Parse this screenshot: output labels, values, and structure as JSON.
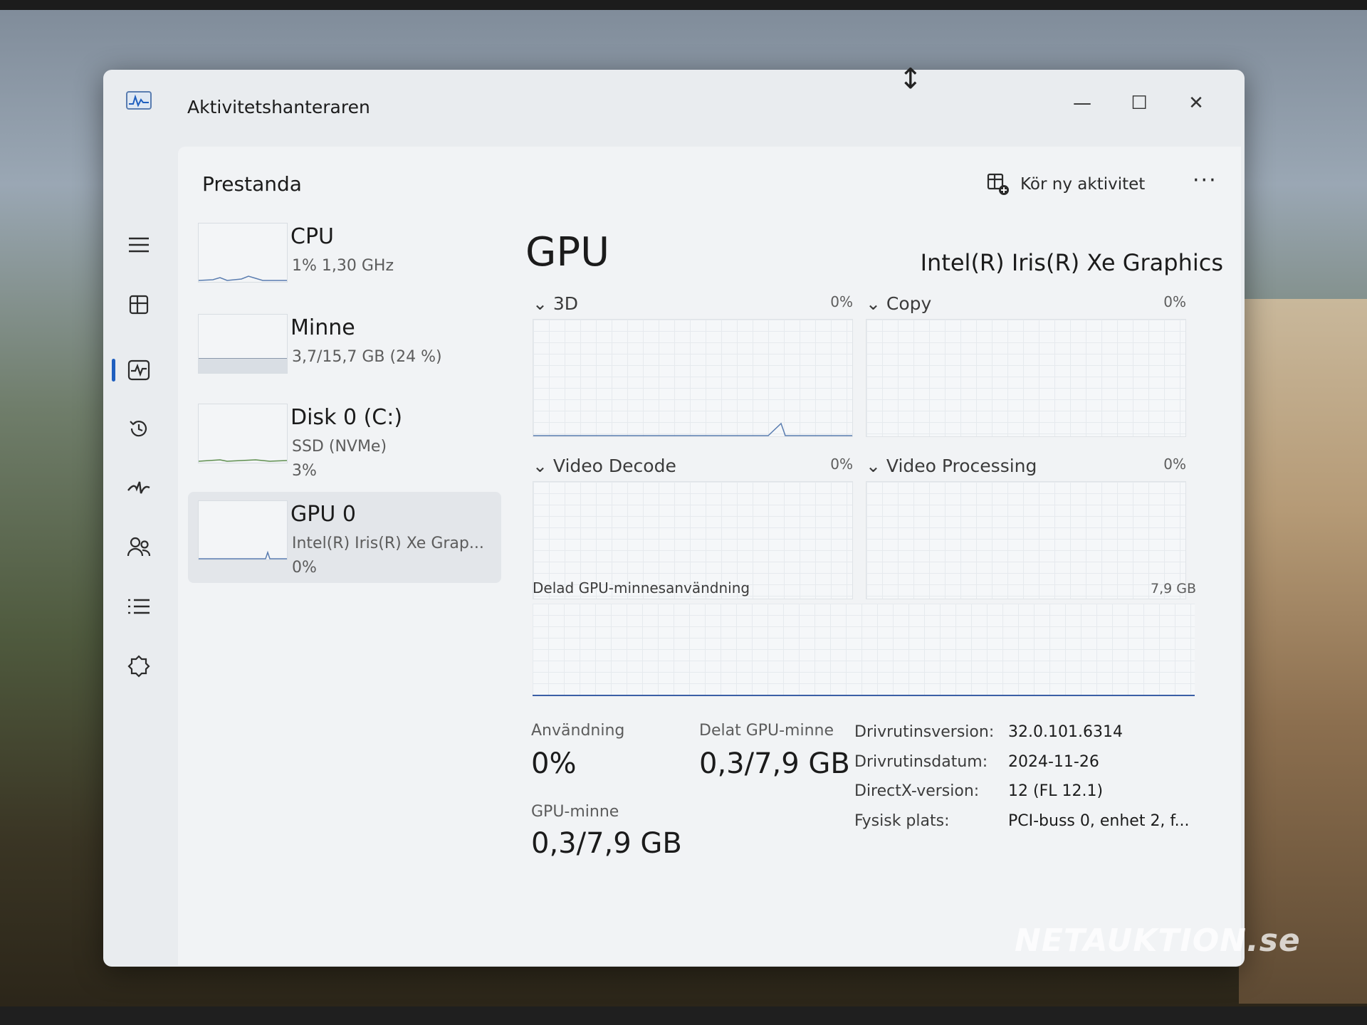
{
  "window": {
    "title": "Aktivitetshanteraren",
    "controls": {
      "minimize": "—",
      "maximize": "☐",
      "close": "✕"
    }
  },
  "header": {
    "page_title": "Prestanda",
    "run_task_label": "Kör ny aktivitet",
    "more_label": "···"
  },
  "nav": {
    "items": [
      "menu-icon",
      "processes-icon",
      "performance-icon",
      "app-history-icon",
      "startup-apps-icon",
      "users-icon",
      "details-icon",
      "services-icon",
      "settings-icon"
    ],
    "active": "performance-icon",
    "accent": "#1f5fbf"
  },
  "perf_list": [
    {
      "name": "CPU",
      "line1": "1%  1,30 GHz",
      "line2": ""
    },
    {
      "name": "Minne",
      "line1": "3,7/15,7 GB (24 %)",
      "line2": ""
    },
    {
      "name": "Disk 0 (C:)",
      "line1": "SSD (NVMe)",
      "line2": "3%"
    },
    {
      "name": "GPU 0",
      "line1": "Intel(R) Iris(R) Xe Grap...",
      "line2": "0%"
    }
  ],
  "detail": {
    "title": "GPU",
    "model": "Intel(R) Iris(R) Xe Graphics",
    "engines": [
      {
        "label": "3D",
        "percent": "0%"
      },
      {
        "label": "Copy",
        "percent": "0%"
      },
      {
        "label": "Video Decode",
        "percent": "0%"
      },
      {
        "label": "Video Processing",
        "percent": "0%"
      }
    ],
    "shared_memory": {
      "label": "Delad GPU-minnesanvändning",
      "max": "7,9 GB"
    },
    "stats": {
      "usage_label": "Användning",
      "usage_value": "0%",
      "shared_label": "Delat GPU-minne",
      "shared_value": "0,3/7,9 GB",
      "gpu_mem_label": "GPU-minne",
      "gpu_mem_value": "0,3/7,9 GB"
    },
    "properties": [
      {
        "label": "Drivrutinsversion:",
        "value": "32.0.101.6314"
      },
      {
        "label": "Drivrutinsdatum:",
        "value": "2024-11-26"
      },
      {
        "label": "DirectX-version:",
        "value": "12 (FL 12.1)"
      },
      {
        "label": "Fysisk plats:",
        "value": "PCI-buss 0, enhet 2, f..."
      }
    ]
  },
  "watermark": "NETAUKTION.se"
}
